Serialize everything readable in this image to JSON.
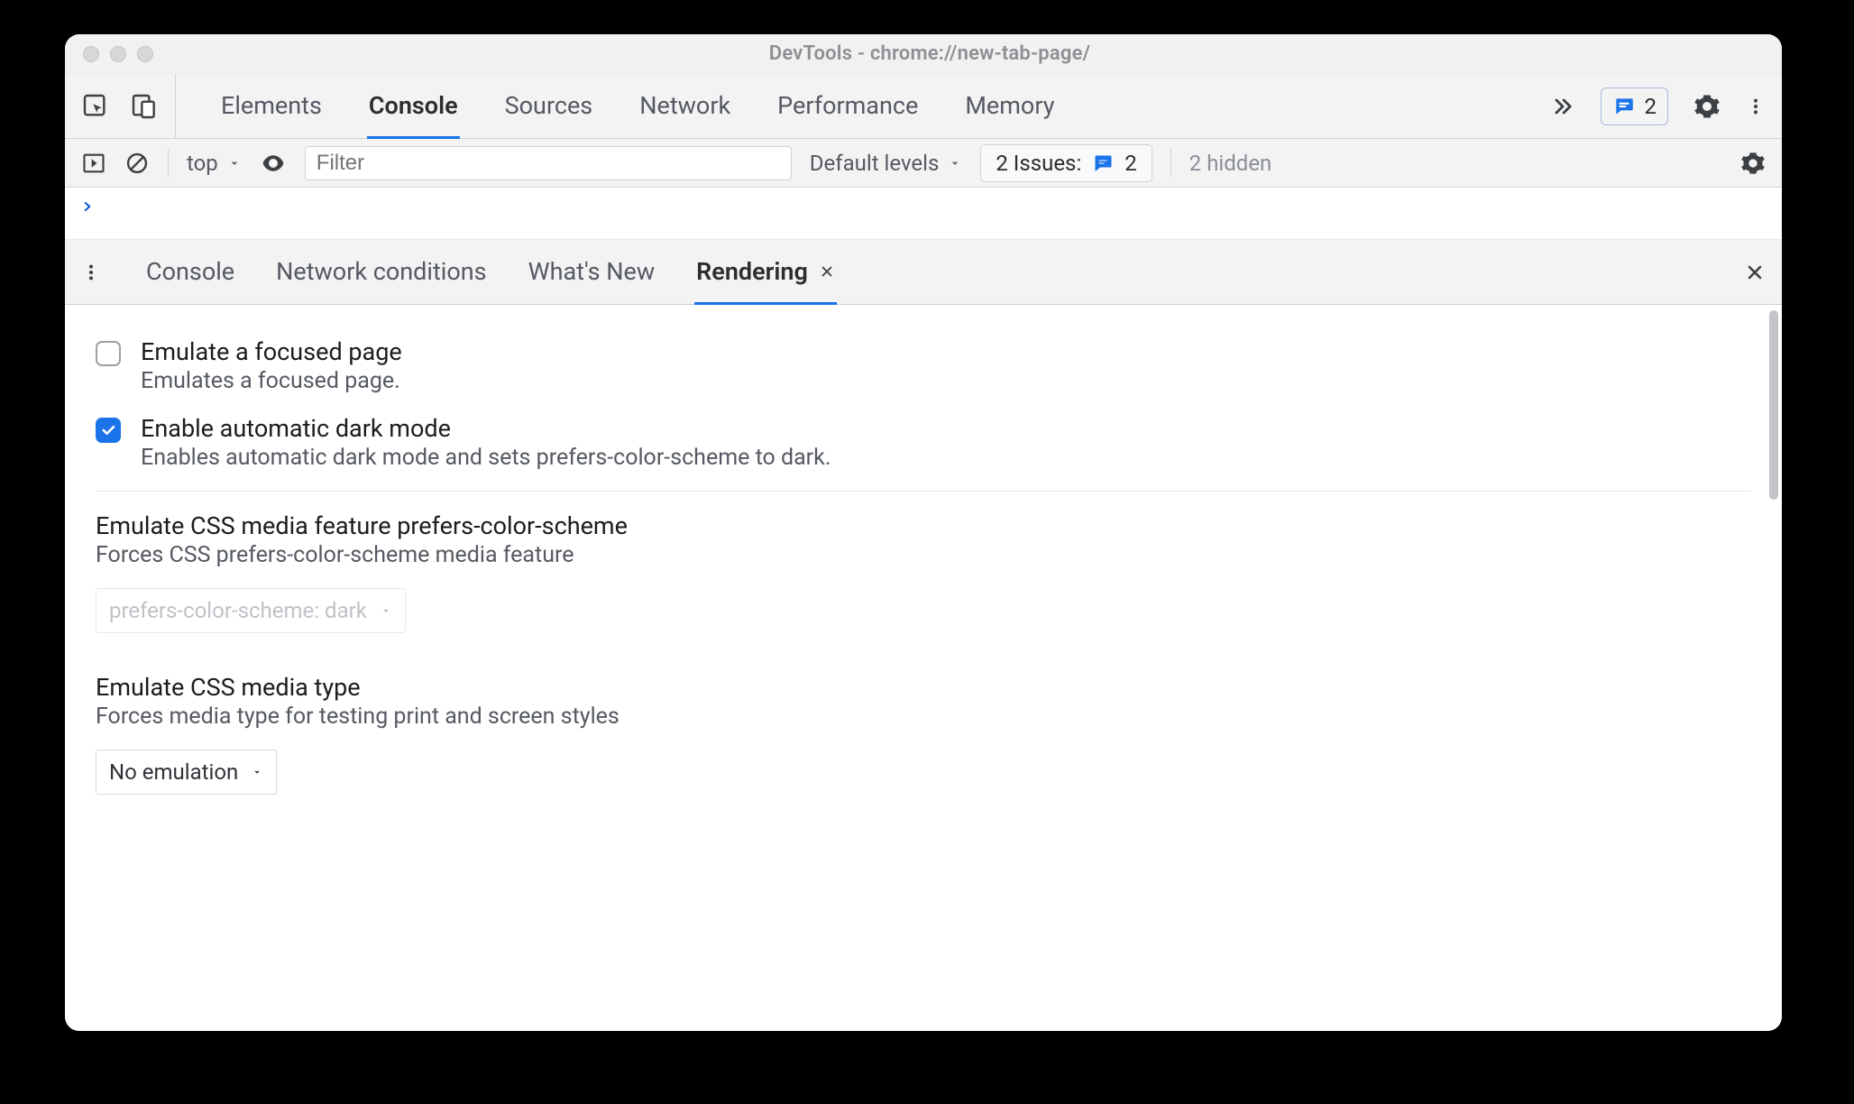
{
  "window": {
    "title": "DevTools - chrome://new-tab-page/"
  },
  "tabs": {
    "items": [
      "Elements",
      "Console",
      "Sources",
      "Network",
      "Performance",
      "Memory"
    ],
    "active_index": 1,
    "overflow_icon": "double-chevron-right-icon",
    "messages_count": "2"
  },
  "consoleToolbar": {
    "context": "top",
    "filter_placeholder": "Filter",
    "levels_label": "Default levels",
    "issues_label": "2 Issues:",
    "issues_count": "2",
    "hidden_text": "2 hidden"
  },
  "consolePrompt": {
    "prompt": "›"
  },
  "drawer": {
    "tabs": [
      "Console",
      "Network conditions",
      "What's New",
      "Rendering"
    ],
    "active_index": 3
  },
  "rendering": {
    "opt1": {
      "title": "Emulate a focused page",
      "desc": "Emulates a focused page.",
      "checked": false
    },
    "opt2": {
      "title": "Enable automatic dark mode",
      "desc": "Enables automatic dark mode and sets prefers-color-scheme to dark.",
      "checked": true
    },
    "prefersColorScheme": {
      "title": "Emulate CSS media feature prefers-color-scheme",
      "desc": "Forces CSS prefers-color-scheme media feature",
      "value": "prefers-color-scheme: dark"
    },
    "mediaType": {
      "title": "Emulate CSS media type",
      "desc": "Forces media type for testing print and screen styles",
      "value": "No emulation"
    }
  }
}
